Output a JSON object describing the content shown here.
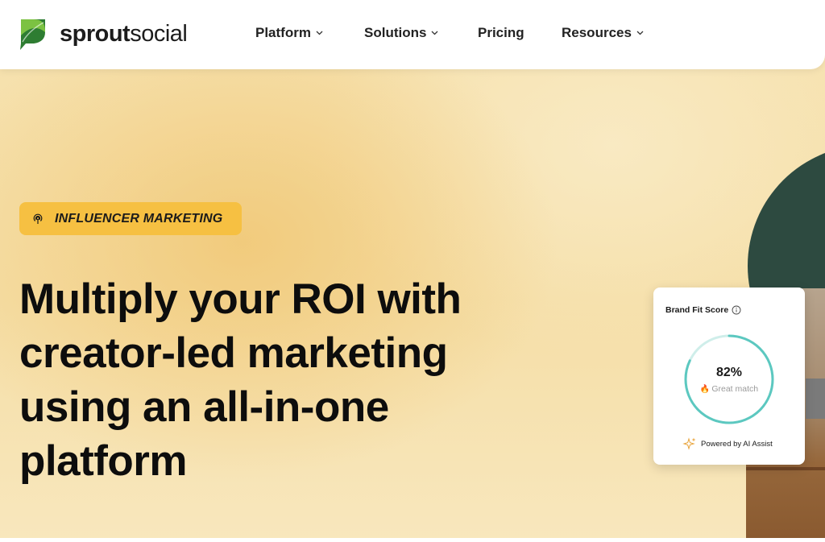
{
  "brand": {
    "name_bold": "sprout",
    "name_light": "social",
    "colors": {
      "leaf_dark": "#2e7d32",
      "leaf_light": "#7cc242",
      "badge": "#f6c042",
      "accent_teal": "#5cc8c0"
    }
  },
  "nav": {
    "items": [
      {
        "label": "Platform",
        "has_dropdown": true
      },
      {
        "label": "Solutions",
        "has_dropdown": true
      },
      {
        "label": "Pricing",
        "has_dropdown": false
      },
      {
        "label": "Resources",
        "has_dropdown": true
      }
    ]
  },
  "hero": {
    "badge": {
      "label": "INFLUENCER MARKETING",
      "icon": "influencer-broadcast-icon"
    },
    "headline": "Multiply your ROI with creator-led marketing using an all-in-one platform"
  },
  "brand_fit_card": {
    "title": "Brand Fit Score",
    "score_percent": 82,
    "score_label": "82%",
    "match_label": "Great match",
    "footer": "Powered by AI Assist",
    "icons": [
      "info-icon",
      "flame-icon",
      "sparkle-icon"
    ]
  }
}
